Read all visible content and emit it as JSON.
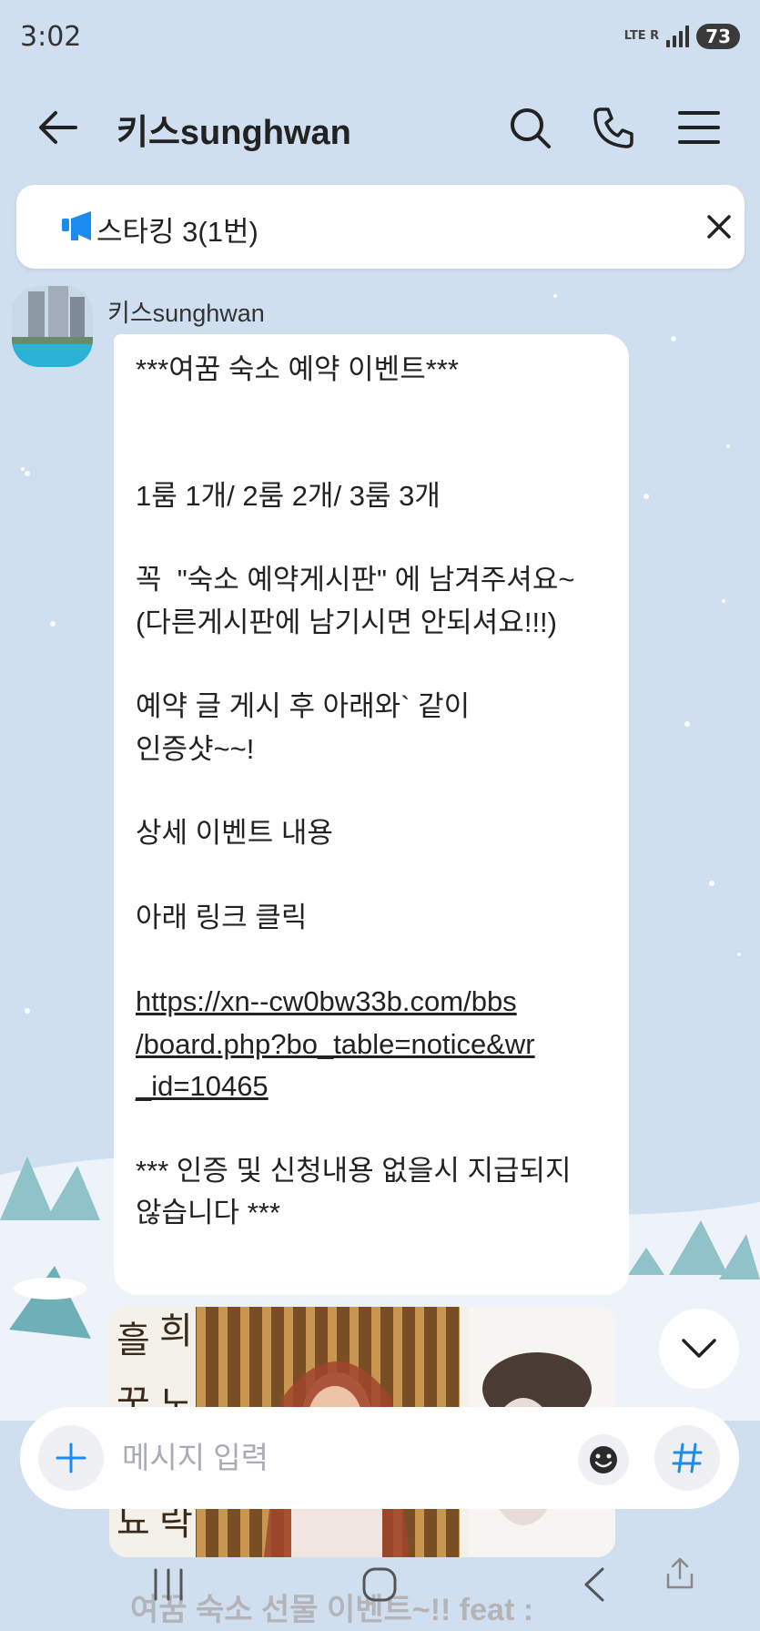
{
  "status_bar": {
    "time": "3:02",
    "network": "LTE R",
    "battery": "73"
  },
  "header": {
    "title": "키스sunghwan",
    "icons": [
      "back-arrow-icon",
      "search-icon",
      "phone-icon",
      "menu-icon"
    ]
  },
  "notice": {
    "text": "스타킹 3(1번)",
    "icon": "megaphone-icon"
  },
  "message": {
    "sender": "키스sunghwan",
    "body_before_link": "***여꿈 숙소 예약 이벤트***\n\n\n1룸 1개/ 2룸 2개/ 3룸 3개\n\n꼭  \"숙소 예약게시판\" 에 남겨주셔요~\n(다른게시판에 남기시면 안되셔요!!!)\n\n예약 글 게시 후 아래와` 같이\n인증샷~~!\n\n상세 이벤트 내용\n\n아래 링크 클릭\n\n",
    "link": "https://xn--cw0bw33b.com/bbs\n/board.php?bo_table=notice&wr\n_id=10465",
    "body_after_link": "\n\n*** 인증 및 신청내용 없을시 지급되지\n않습니다 ***"
  },
  "image_message": {
    "caption": "여꿈 숙소 선물 이벤트~!! feat :"
  },
  "input": {
    "placeholder": "메시지 입력",
    "value": ""
  },
  "colors": {
    "background": "#cfdff0",
    "accent_blue": "#1a8cf0",
    "bubble": "#ffffff"
  }
}
